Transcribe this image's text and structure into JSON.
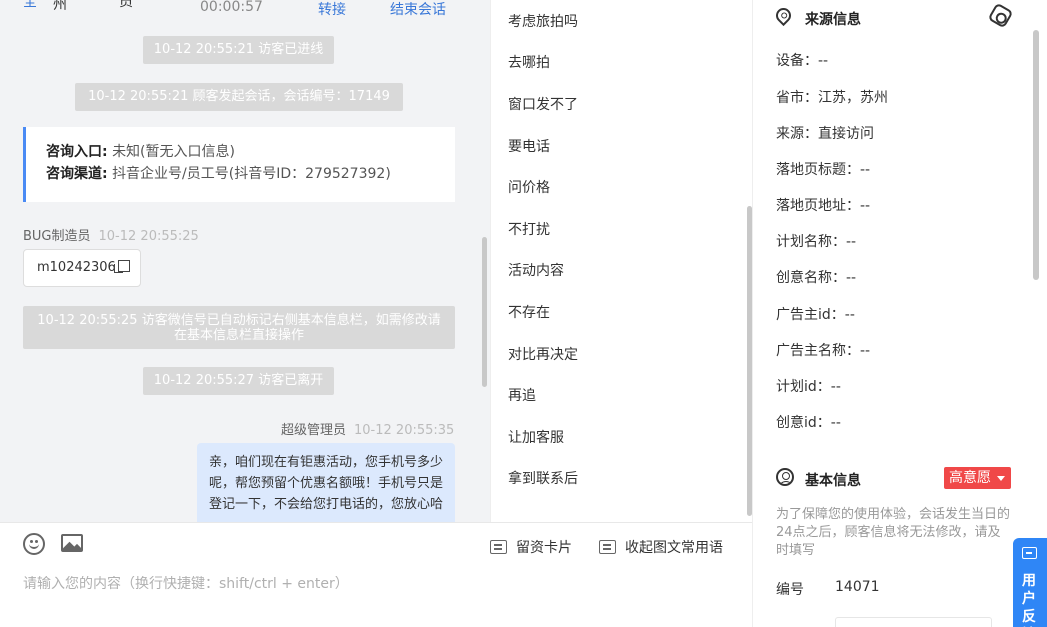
{
  "chat": {
    "top_strip": {
      "glyph_left": "全",
      "glyph_region": "州",
      "glyph_role": "员",
      "duration": "00:00:57",
      "transfer_label": "转接",
      "end_label": "结束会话"
    },
    "events": {
      "visitor_entered": "10-12 20:55:21 访客已进线",
      "session_started": "10-12 20:55:21 顾客发起会话，会话编号：17149",
      "wechat_auto_tag": "10-12 20:55:25 访客微信号已自动标记右侧基本信息栏，如需修改请在基本信息栏直接操作",
      "visitor_left": "10-12 20:55:27 访客已离开"
    },
    "consult_card": {
      "entry_label": "咨询入口:",
      "entry_value": "未知(暂无入口信息)",
      "channel_label": "咨询渠道:",
      "channel_value": "抖音企业号/员工号(抖音号ID：279527392)"
    },
    "message_bug": {
      "sender": "BUG制造员",
      "time": "10-12 20:55:25",
      "content": "m10242306"
    },
    "message_admin": {
      "sender": "超级管理员",
      "time": "10-12 20:55:35",
      "content": "亲，咱们现在有钜惠活动，您手机号多少呢，帮您预留个优惠名额哦！手机号只是登记一下，不会给您打电话的，您放心哈"
    }
  },
  "input": {
    "placeholder": "请输入您的内容（换行快捷键：shift/ctrl + enter）",
    "contact_card_label": "留资卡片",
    "collapse_phrases_label": "收起图文常用语"
  },
  "quick_phrases": [
    "考虑旅拍吗",
    "去哪拍",
    "窗口发不了",
    "要电话",
    "问价格",
    "不打扰",
    "活动内容",
    "不存在",
    "对比再决定",
    "再追",
    "让加客服",
    "拿到联系后"
  ],
  "source_info": {
    "title": "来源信息",
    "fields": [
      {
        "label": "设备：",
        "value": "--"
      },
      {
        "label": "省市：",
        "value": "江苏，苏州"
      },
      {
        "label": "来源：",
        "value": "直接访问"
      },
      {
        "label": "落地页标题：",
        "value": "--"
      },
      {
        "label": "落地页地址：",
        "value": "--"
      },
      {
        "label": "计划名称：",
        "value": "--"
      },
      {
        "label": "创意名称：",
        "value": "--"
      },
      {
        "label": "广告主id：",
        "value": "--"
      },
      {
        "label": "广告主名称：",
        "value": "--"
      },
      {
        "label": "计划id：",
        "value": "--"
      },
      {
        "label": "创意id：",
        "value": "--"
      }
    ]
  },
  "basic_info": {
    "title": "基本信息",
    "intent_badge": "高意愿",
    "notice": "为了保障您的使用体验，会话发生当日的24点之后，顾客信息将无法修改，请及时填写",
    "id_label": "编号",
    "id_value": "14071"
  },
  "feedback": {
    "label": "用户反馈"
  },
  "colors": {
    "accent": "#3a78d8",
    "badge_red": "#f04848",
    "bubble_blue": "#dce9fd",
    "feedback_blue": "#2f86f6"
  },
  "icons": [
    "location-icon",
    "gear-icon",
    "user-circle-icon",
    "emoji-icon",
    "image-icon",
    "message-icon",
    "copy-icon",
    "feedback-icon"
  ]
}
